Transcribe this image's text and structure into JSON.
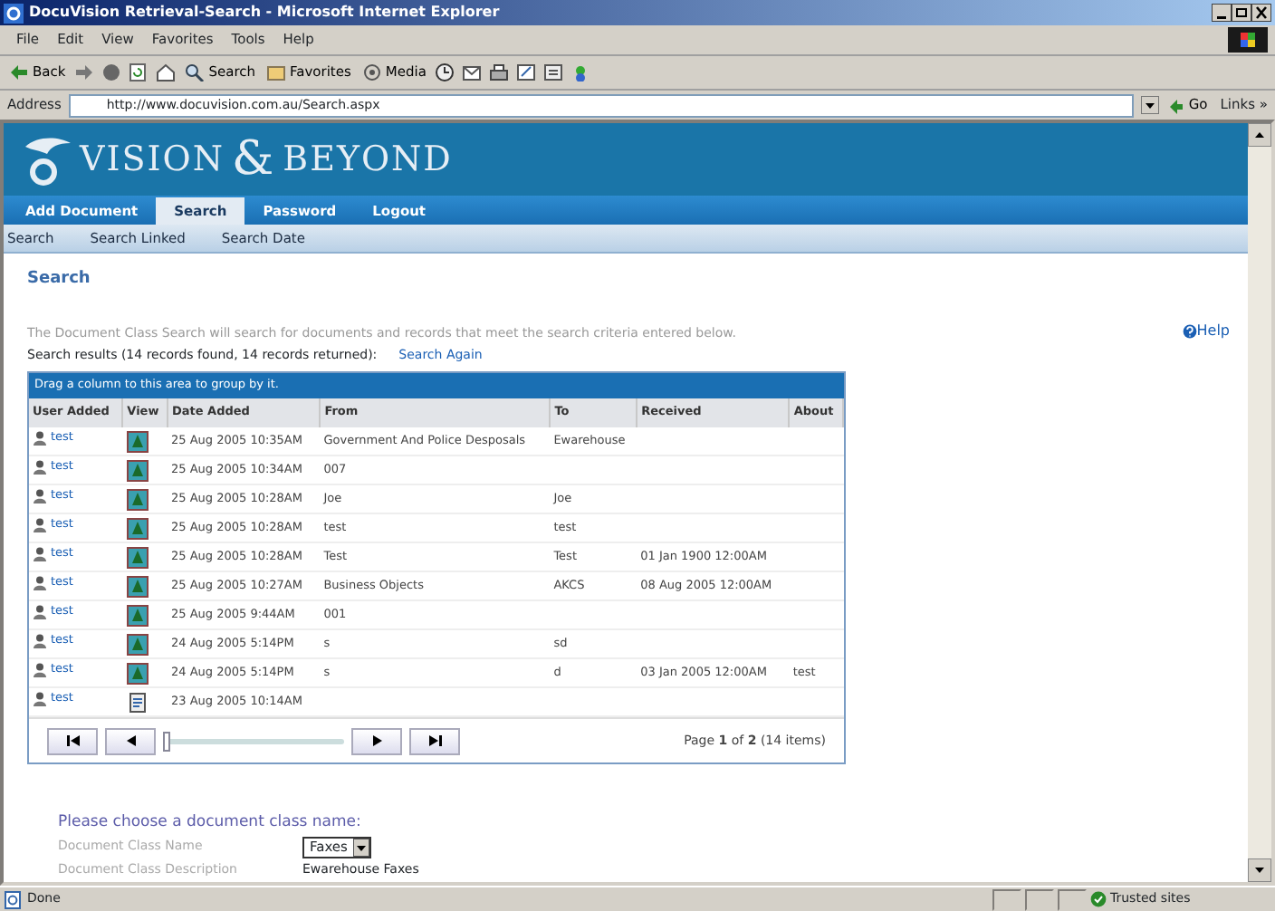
{
  "window": {
    "title": "DocuVision Retrieval-Search - Microsoft Internet Explorer"
  },
  "menu": [
    "File",
    "Edit",
    "View",
    "Favorites",
    "Tools",
    "Help"
  ],
  "toolbar": [
    {
      "kind": "back",
      "label": "Back"
    },
    {
      "kind": "forward"
    },
    {
      "kind": "stop"
    },
    {
      "kind": "refresh"
    },
    {
      "kind": "home"
    },
    {
      "kind": "search",
      "label": "Search"
    },
    {
      "kind": "favorites",
      "label": "Favorites"
    },
    {
      "kind": "media",
      "label": "Media"
    },
    {
      "kind": "history"
    },
    {
      "kind": "mail"
    },
    {
      "kind": "print"
    },
    {
      "kind": "edit"
    },
    {
      "kind": "discuss"
    },
    {
      "kind": "messenger"
    }
  ],
  "address": {
    "label": "Address",
    "value": "http://www.docuvision.com.au/Search.aspx",
    "go": "Go",
    "links": "Links »"
  },
  "logo": {
    "text_1": "VISION",
    "amp": "&",
    "text_2": "BEYOND"
  },
  "tabs": [
    {
      "label": "Add Document",
      "selected": false
    },
    {
      "label": "Search",
      "selected": true
    },
    {
      "label": "Password",
      "selected": false
    },
    {
      "label": "Logout",
      "selected": false
    }
  ],
  "subnav": [
    "Search",
    "Search Linked",
    "Search Date"
  ],
  "heading": "Search",
  "description": "The Document Class Search will search for documents and records that meet the search criteria entered below.",
  "help": "Help",
  "results": {
    "summary": "Search results (14 records found, 14 records returned):",
    "link": "Search Again"
  },
  "grid": {
    "group_hint": "Drag a column to this area to group by it.",
    "columns": [
      "User Added",
      "View",
      "Date Added",
      "From",
      "To",
      "Received",
      "About"
    ],
    "rows": [
      {
        "user": "test",
        "kind": "image",
        "date": "25 Aug 2005 10:35AM",
        "from": "Government And Police Desposals",
        "to": "Ewarehouse"
      },
      {
        "user": "test",
        "kind": "image",
        "date": "25 Aug 2005 10:34AM",
        "from": "007"
      },
      {
        "user": "test",
        "kind": "image",
        "date": "25 Aug 2005 10:28AM",
        "from": "Joe",
        "to": "Joe"
      },
      {
        "user": "test",
        "kind": "image",
        "date": "25 Aug 2005 10:28AM",
        "from": "test",
        "to": "test"
      },
      {
        "user": "test",
        "kind": "image",
        "date": "25 Aug 2005 10:28AM",
        "from": "Test",
        "to": "Test",
        "received": "01 Jan 1900 12:00AM"
      },
      {
        "user": "test",
        "kind": "image",
        "date": "25 Aug 2005 10:27AM",
        "from": "Business Objects",
        "to": "AKCS",
        "received": "08 Aug 2005 12:00AM"
      },
      {
        "user": "test",
        "kind": "image",
        "date": "25 Aug 2005 9:44AM",
        "from": "001"
      },
      {
        "user": "test",
        "kind": "image",
        "date": "24 Aug 2005 5:14PM",
        "from": "s",
        "to": "sd"
      },
      {
        "user": "test",
        "kind": "image",
        "date": "24 Aug 2005 5:14PM",
        "from": "s",
        "to": "d",
        "received": "03 Jan 2005 12:00AM",
        "about": "test"
      },
      {
        "user": "test",
        "kind": "note",
        "date": "23 Aug 2005 10:14AM"
      }
    ],
    "pager": {
      "level": 0.0,
      "page_prefix": "Page ",
      "page": "1",
      "page_of": " of ",
      "pages": "2",
      "items": " (14 items)"
    }
  },
  "class_form": {
    "title": "Please choose a document class name:",
    "name_label": "Document Class Name",
    "name_value": "Faxes",
    "desc_label": "Document Class Description",
    "desc_value": "Ewarehouse Faxes"
  },
  "status_bar": {
    "text": "Done",
    "zone": "Trusted sites"
  }
}
